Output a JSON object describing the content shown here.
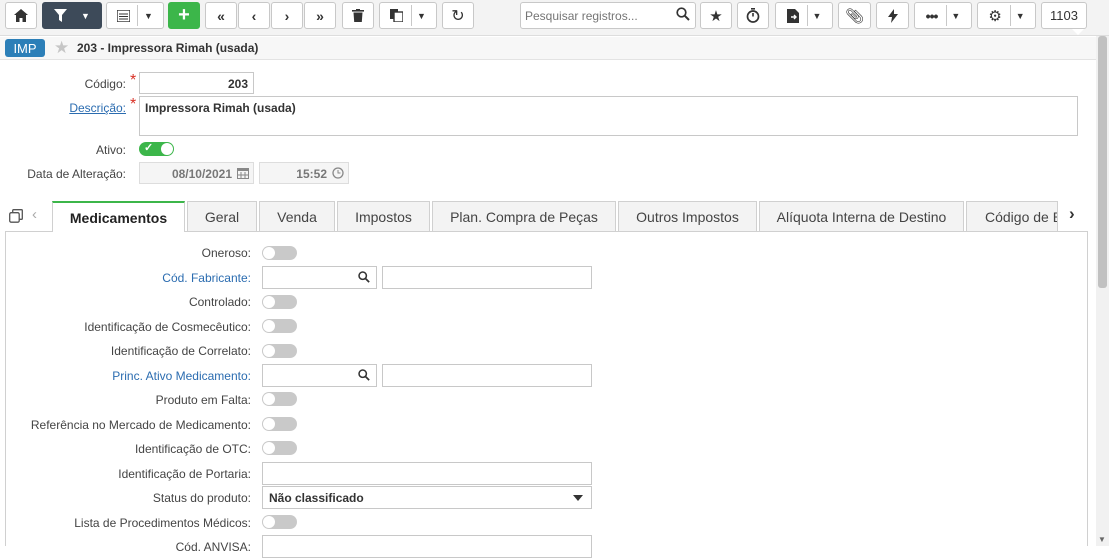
{
  "toolbar": {
    "search_placeholder": "Pesquisar registros...",
    "record_count": "1103",
    "icons": [
      "home-icon",
      "filter-icon",
      "list-icon",
      "plus-icon",
      "first-icon",
      "prev-icon",
      "next-icon",
      "last-icon",
      "trash-icon",
      "copy-icon",
      "refresh-icon",
      "search-icon",
      "star-icon",
      "stopwatch-icon",
      "export-icon",
      "paperclip-icon",
      "bolt-icon",
      "more-icon",
      "gear-icon"
    ]
  },
  "header": {
    "badge": "IMP",
    "title": "203 - Impressora Rimah (usada)"
  },
  "form": {
    "codigo_label": "Código:",
    "codigo_value": "203",
    "descricao_label": "Descrição:",
    "descricao_value": "Impressora Rimah (usada)",
    "ativo_label": "Ativo:",
    "ativo_on": true,
    "data_label": "Data de Alteração:",
    "data_value": "08/10/2021",
    "hora_value": "15:52"
  },
  "tabs": [
    "Medicamentos",
    "Geral",
    "Venda",
    "Impostos",
    "Plan. Compra de Peças",
    "Outros Impostos",
    "Alíquota Interna de Destino",
    "Código de B"
  ],
  "active_tab": 0,
  "medicamentos": {
    "oneroso": "Oneroso:",
    "cod_fabricante": "Cód. Fabricante:",
    "controlado": "Controlado:",
    "cosmeceutico": "Identificação de Cosmecêutico:",
    "correlato": "Identificação de Correlato:",
    "princ_ativo": "Princ. Ativo Medicamento:",
    "produto_falta": "Produto em Falta:",
    "referencia": "Referência no Mercado de Medicamento:",
    "otc": "Identificação de OTC:",
    "portaria": "Identificação de Portaria:",
    "status": "Status do produto:",
    "status_value": "Não classificado",
    "procedimentos": "Lista de Procedimentos Médicos:",
    "anvisa": "Cód. ANVISA:"
  },
  "colors": {
    "accent_green": "#3cb64a",
    "badge_blue": "#2c7fb8",
    "toolbar_dark": "#3d4a59",
    "link_blue": "#2b6cb0",
    "required_red": "#d93025"
  }
}
